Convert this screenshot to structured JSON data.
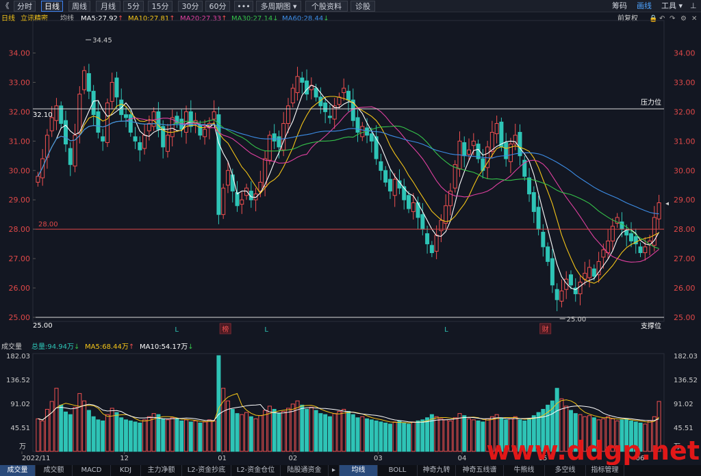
{
  "toolbar": {
    "back_glyph": "《",
    "buttons": [
      "分时",
      "日线",
      "周线",
      "月线",
      "5分",
      "15分",
      "30分",
      "60分",
      "•••",
      "多周期图",
      "个股资料",
      "诊股"
    ],
    "active": "日线",
    "dropdown_glyph": "▾",
    "right": [
      "筹码",
      "画线",
      "工具"
    ]
  },
  "ma_bar": {
    "period": "日线",
    "name": "立讯精密",
    "mode": "均线",
    "items": [
      {
        "label": "MA5:27.92",
        "arrow": "↑",
        "color": "#ffffff"
      },
      {
        "label": "MA10:27.81",
        "arrow": "↑",
        "color": "#f5c518"
      },
      {
        "label": "MA20:27.33",
        "arrow": "↑",
        "color": "#e040a0"
      },
      {
        "label": "MA30:27.14",
        "arrow": "↓",
        "color": "#35c24a"
      },
      {
        "label": "MA60:28.44",
        "arrow": "↓",
        "color": "#3d8ee8"
      }
    ],
    "right_label": "前复权",
    "icons": [
      "lock-icon",
      "undo-icon",
      "redo-icon",
      "settings-icon",
      "close-icon"
    ]
  },
  "vol_bar": {
    "title": "成交量",
    "items": [
      {
        "label": "总量:94.94万",
        "arrow": "↓",
        "color": "#2ec4b6"
      },
      {
        "label": "MA5:68.44万",
        "arrow": "↑",
        "color": "#f5c518"
      },
      {
        "label": "MA10:54.17万",
        "arrow": "↓",
        "color": "#ffffff"
      }
    ]
  },
  "bottom_tabs": [
    "成交量",
    "成交额",
    "MACD",
    "KDJ",
    "主力净额",
    "L2-资金抄底",
    "L2-资金仓位",
    "陆股通资金",
    "▸",
    "均线",
    "BOLL",
    "神奇九转",
    "神奇五线谱",
    "牛熊线",
    "多空线",
    "指标管理"
  ],
  "bottom_active": [
    "成交量",
    "均线"
  ],
  "watermark": "www.ddgp.net",
  "chart_data": {
    "type": "candlestick",
    "title": "立讯精密 日线",
    "price_axis": {
      "ticks": [
        "34.00",
        "33.00",
        "32.00",
        "31.00",
        "30.00",
        "29.00",
        "28.00",
        "27.00",
        "26.00",
        "25.00"
      ],
      "ylim": [
        25.0,
        34.5
      ]
    },
    "volume_axis": {
      "ticks": [
        "182.03",
        "136.52",
        "91.02",
        "45.51"
      ],
      "unit": "万"
    },
    "x_labels": [
      "2022/11",
      "12",
      "01",
      "02",
      "03",
      "04",
      "05",
      "06"
    ],
    "annotations": {
      "high_label": "34.45",
      "low_label": "25.00",
      "left_high": "32.10",
      "line_28": "28.00",
      "line_25": "25.00",
      "resistance": "压力位",
      "support": "支撑位"
    },
    "events": [
      {
        "text": "L",
        "type": "L"
      },
      {
        "text": "榜",
        "type": "box"
      },
      {
        "text": "L",
        "type": "L"
      },
      {
        "text": "L",
        "type": "L"
      },
      {
        "text": "财",
        "type": "box"
      }
    ],
    "ma_colors": {
      "MA5": "#ffffff",
      "MA10": "#f5c518",
      "MA20": "#e040a0",
      "MA30": "#35c24a",
      "MA60": "#3d8ee8"
    },
    "close": [
      29.8,
      30.4,
      31.2,
      31.8,
      32.2,
      31.6,
      30.9,
      30.2,
      31.2,
      32.6,
      33.4,
      32.7,
      31.9,
      31.3,
      31.0,
      32.3,
      33.0,
      32.5,
      31.9,
      31.8,
      31.3,
      31.0,
      30.7,
      31.2,
      31.6,
      32.0,
      31.4,
      30.8,
      31.2,
      31.8,
      31.6,
      31.4,
      32.0,
      31.5,
      31.7,
      31.2,
      31.4,
      31.6,
      32.0,
      28.5,
      29.4,
      30.0,
      29.3,
      28.8,
      29.0,
      29.4,
      29.0,
      29.2,
      29.6,
      30.4,
      31.2,
      31.0,
      30.8,
      31.6,
      32.2,
      32.8,
      33.2,
      33.0,
      32.6,
      32.9,
      32.5,
      32.2,
      32.0,
      31.8,
      32.2,
      32.5,
      32.8,
      32.4,
      31.7,
      31.3,
      31.5,
      31.2,
      31.0,
      30.4,
      30.0,
      29.6,
      29.3,
      29.7,
      29.4,
      29.0,
      28.7,
      28.9,
      28.4,
      28.0,
      27.5,
      27.2,
      27.8,
      28.3,
      28.8,
      29.3,
      30.2,
      31.0,
      30.5,
      30.7,
      31.0,
      30.4,
      30.0,
      30.8,
      31.3,
      31.6,
      30.8,
      30.4,
      30.9,
      31.2,
      30.5,
      29.8,
      29.2,
      28.6,
      28.0,
      27.4,
      26.9,
      26.1,
      25.6,
      25.9,
      26.3,
      26.1,
      25.8,
      26.2,
      26.5,
      26.7,
      26.4,
      26.9,
      27.3,
      27.6,
      28.1,
      28.4,
      28.0,
      27.8,
      27.6,
      27.5,
      27.2,
      27.4,
      27.6,
      28.4,
      28.9
    ],
    "volume": [
      62,
      58,
      80,
      95,
      120,
      88,
      75,
      70,
      84,
      110,
      96,
      78,
      66,
      60,
      58,
      70,
      82,
      74,
      64,
      60,
      58,
      56,
      54,
      60,
      66,
      72,
      70,
      62,
      60,
      64,
      62,
      58,
      60,
      56,
      58,
      54,
      56,
      60,
      58,
      182,
      120,
      96,
      80,
      72,
      70,
      74,
      66,
      62,
      68,
      78,
      86,
      80,
      72,
      76,
      82,
      90,
      96,
      88,
      80,
      84,
      78,
      72,
      70,
      66,
      72,
      76,
      80,
      76,
      70,
      64,
      66,
      62,
      60,
      58,
      56,
      54,
      52,
      56,
      58,
      54,
      52,
      56,
      58,
      60,
      64,
      70,
      66,
      62,
      60,
      58,
      64,
      72,
      68,
      62,
      60,
      58,
      56,
      62,
      66,
      70,
      64,
      60,
      62,
      66,
      60,
      58,
      62,
      68,
      74,
      80,
      88,
      96,
      120,
      100,
      86,
      78,
      72,
      70,
      66,
      68,
      64,
      60,
      62,
      66,
      62,
      58,
      60,
      62,
      58,
      56,
      54,
      52,
      58,
      66,
      95
    ],
    "volume_up_color": "#f05050",
    "volume_down_color": "#2ec4b6"
  }
}
